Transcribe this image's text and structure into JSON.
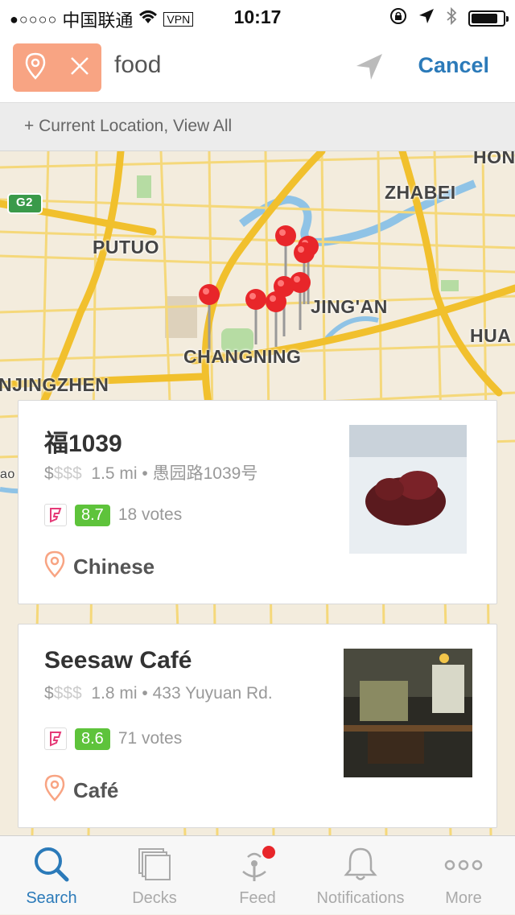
{
  "status_bar": {
    "signal": "●○○○○",
    "carrier": "中国联通",
    "vpn": "VPN",
    "time": "10:17",
    "battery_level": 0.85
  },
  "search": {
    "query": "food",
    "cancel_label": "Cancel"
  },
  "view_all": "+  Current Location, View All",
  "map": {
    "labels": {
      "putuo": "PUTUO",
      "zhabei": "ZHABEI",
      "jingan": "JING'AN",
      "changning": "CHANGNING",
      "hongkou": "HON",
      "huangpu": "HUA",
      "hongqiao": "NJINGZHEN",
      "highway": "G2",
      "edge": "ao"
    }
  },
  "results": [
    {
      "name": "福1039",
      "price_active": "$",
      "price_inactive": "$$$",
      "distance": "1.5 mi",
      "address": "愚园路1039号",
      "score": "8.7",
      "votes": "18 votes",
      "category": "Chinese"
    },
    {
      "name": "Seesaw Café",
      "price_active": "$",
      "price_inactive": "$$$",
      "distance": "1.8 mi",
      "address": "433 Yuyuan Rd.",
      "score": "8.6",
      "votes": "71 votes",
      "category": "Café"
    }
  ],
  "tabs": [
    {
      "label": "Search",
      "icon": "search-icon",
      "active": true
    },
    {
      "label": "Decks",
      "icon": "decks-icon",
      "active": false
    },
    {
      "label": "Feed",
      "icon": "feed-icon",
      "active": false
    },
    {
      "label": "Notifications",
      "icon": "bell-icon",
      "active": false
    },
    {
      "label": "More",
      "icon": "more-icon",
      "active": false
    }
  ],
  "colors": {
    "accent": "#2b7ab9",
    "location_chip": "#f8a483",
    "score_green": "#5ec33b",
    "pin_red": "#e8262a"
  }
}
